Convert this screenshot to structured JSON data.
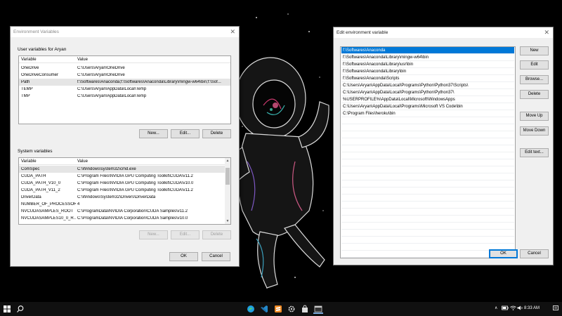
{
  "env_window": {
    "title": "Environment Variables",
    "user_group_label": "User variables for Aryan",
    "user_columns": [
      "Variable",
      "Value"
    ],
    "user_rows": [
      {
        "variable": "OneDrive",
        "value": "C:\\Users\\Aryan\\OneDrive"
      },
      {
        "variable": "OneDriveConsumer",
        "value": "C:\\Users\\Aryan\\OneDrive"
      },
      {
        "variable": "Path",
        "value": "f:\\Softwares\\Anaconda;f:\\Softwares\\Anaconda\\Library\\mingw-w64\\bin;f:\\Sof..."
      },
      {
        "variable": "TEMP",
        "value": "C:\\Users\\Aryan\\AppData\\Local\\Temp"
      },
      {
        "variable": "TMP",
        "value": "C:\\Users\\Aryan\\AppData\\Local\\Temp"
      }
    ],
    "user_buttons": {
      "new": "New...",
      "edit": "Edit...",
      "delete": "Delete"
    },
    "system_group_label": "System variables",
    "system_columns": [
      "Variable",
      "Value"
    ],
    "system_rows": [
      {
        "variable": "ComSpec",
        "value": "C:\\Windows\\system32\\cmd.exe"
      },
      {
        "variable": "CUDA_PATH",
        "value": "C:\\Program Files\\NVIDIA GPU Computing Toolkit\\CUDA\\v11.2"
      },
      {
        "variable": "CUDA_PATH_V10_0",
        "value": "C:\\Program Files\\NVIDIA GPU Computing Toolkit\\CUDA\\v10.0"
      },
      {
        "variable": "CUDA_PATH_V11_2",
        "value": "C:\\Program Files\\NVIDIA GPU Computing Toolkit\\CUDA\\v11.2"
      },
      {
        "variable": "DriverData",
        "value": "C:\\Windows\\System32\\Drivers\\DriverData"
      },
      {
        "variable": "NUMBER_OF_PROCESSORS",
        "value": "4"
      },
      {
        "variable": "NVCUDASAMPLES_ROOT",
        "value": "C:\\ProgramData\\NVIDIA Corporation\\CUDA Samples\\v11.2"
      },
      {
        "variable": "NVCUDASAMPLES10_0_R...",
        "value": "C:\\ProgramData\\NVIDIA Corporation\\CUDA Samples\\v10.0"
      }
    ],
    "system_buttons": {
      "new": "New...",
      "edit": "Edit...",
      "delete": "Delete"
    },
    "ok": "OK",
    "cancel": "Cancel"
  },
  "edit_window": {
    "title": "Edit environment variable",
    "entries": [
      "f:\\Softwares\\Anaconda",
      "f:\\Softwares\\Anaconda\\Library\\mingw-w64\\bin",
      "f:\\Softwares\\Anaconda\\Library\\usr\\bin",
      "f:\\Softwares\\Anaconda\\Library\\bin",
      "f:\\Softwares\\Anaconda\\Scripts",
      "C:\\Users\\Aryan\\AppData\\Local\\Programs\\Python\\Python37\\Scripts\\",
      "C:\\Users\\Aryan\\AppData\\Local\\Programs\\Python\\Python37\\",
      "%USERPROFILE%\\AppData\\Local\\Microsoft\\WindowsApps",
      "C:\\Users\\Aryan\\AppData\\Local\\Programs\\Microsoft VS Code\\bin",
      "C:\\Program Files\\heroku\\bin"
    ],
    "buttons": {
      "new": "New",
      "edit": "Edit",
      "browse": "Browse...",
      "delete": "Delete",
      "move_up": "Move Up",
      "move_down": "Move Down",
      "edit_text": "Edit text..."
    },
    "ok": "OK",
    "cancel": "Cancel"
  },
  "taskbar": {
    "icons": [
      "windows-start-icon",
      "search-icon",
      "edge-icon",
      "vscode-icon",
      "sublime-text-icon",
      "settings-icon",
      "store-icon",
      "terminal-icon"
    ],
    "tray_icons": [
      "chevron-up-icon",
      "battery-icon",
      "wifi-icon",
      "volume-icon"
    ],
    "time": "8:33 AM"
  },
  "colors": {
    "selection": "#0078d7",
    "taskbar": "#101010",
    "window_bg": "#f0f0f0"
  }
}
